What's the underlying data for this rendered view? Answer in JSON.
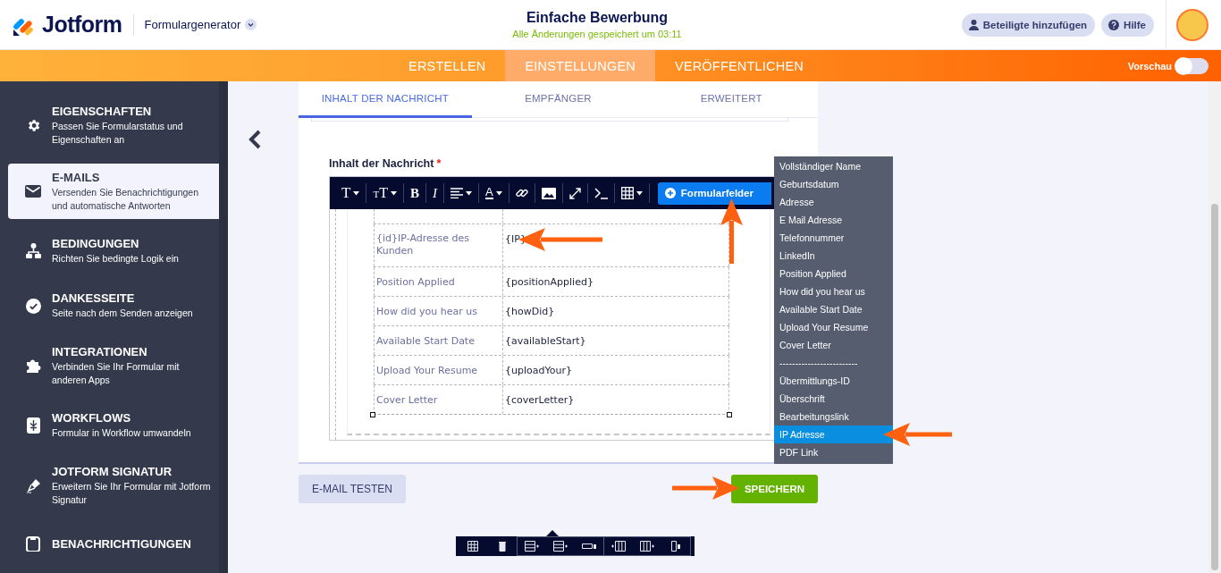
{
  "header": {
    "logo": "Jotform",
    "product": "Formulargenerator",
    "title": "Einfache Bewerbung",
    "save_status": "Alle Änderungen gespeichert um 03:11",
    "buttons": [
      {
        "label": "Beteiligte hinzufügen",
        "kind": "person"
      },
      {
        "label": "Hilfe",
        "kind": "help"
      }
    ]
  },
  "nav": {
    "tabs": [
      {
        "label": "ERSTELLEN",
        "selected": false
      },
      {
        "label": "EINSTELLUNGEN",
        "selected": true
      },
      {
        "label": "VERÖFFENTLICHEN",
        "selected": false
      }
    ],
    "preview": {
      "label": "Vorschau",
      "on": false
    }
  },
  "sidebar": {
    "items": [
      {
        "title": "EIGENSCHAFTEN",
        "description": "Passen Sie Formularstatus und Eigenschaften an",
        "selected": false
      },
      {
        "title": "E-MAILS",
        "description": "Versenden Sie Benachrichtigungen und automatische Antworten",
        "selected": true
      },
      {
        "title": "BEDINGUNGEN",
        "description": "Richten Sie bedingte Logik ein",
        "selected": false
      },
      {
        "title": "DANKESSEITE",
        "description": "Seite nach dem Senden anzeigen",
        "selected": false
      },
      {
        "title": "INTEGRATIONEN",
        "description": "Verbinden Sie Ihr Formular mit anderen Apps",
        "selected": false
      },
      {
        "title": "WORKFLOWS",
        "description": "Formular in Workflow umwandeln",
        "selected": false
      },
      {
        "title": "JOTFORM SIGNATUR",
        "description": "Erweitern Sie Ihr Formular mit Jotform Signatur",
        "selected": false
      },
      {
        "title": "BENACHRICHTIGUNGEN",
        "selected": false
      }
    ]
  },
  "card": {
    "tabs": [
      {
        "label": "INHALT DER NACHRICHT",
        "selected": true
      },
      {
        "label": "EMPFÄNGER",
        "selected": false
      },
      {
        "label": "ERWEITERT",
        "selected": false
      }
    ],
    "field_label": "Inhalt der Nachricht",
    "required_mark": "*",
    "toolbar": {
      "tools": [
        {
          "kind": "glyph",
          "label": "T",
          "menu": true
        },
        {
          "kind": "size",
          "prefix": "T",
          "label": "T",
          "menu": true
        },
        {
          "kind": "bold",
          "label": "B",
          "menu": false
        },
        {
          "kind": "italic",
          "label": "I",
          "menu": false
        },
        {
          "kind": "align",
          "menu": true
        },
        {
          "kind": "color",
          "label": "A",
          "menu": true
        },
        {
          "kind": "link",
          "menu": false
        },
        {
          "kind": "image",
          "menu": false
        },
        {
          "kind": "expand",
          "menu": false
        },
        {
          "kind": "code",
          "menu": false
        },
        {
          "kind": "table",
          "menu": true
        }
      ],
      "fields_button": "Formularfelder"
    },
    "table_rows": [
      {
        "label": "{id}IP-Adresse des Kunden",
        "tag": "{IP}"
      },
      {
        "label": "Position Applied",
        "tag": "{positionApplied}"
      },
      {
        "label": "How did you hear us",
        "tag": "{howDid}"
      },
      {
        "label": "Available Start Date",
        "tag": "{availableStart}"
      },
      {
        "label": "Upload Your Resume",
        "tag": "{uploadYour}"
      },
      {
        "label": "Cover Letter",
        "tag": "{coverLetter}"
      }
    ],
    "buttons": [
      {
        "label": "E-MAIL TESTEN",
        "kind": "secondary"
      },
      {
        "label": "SPEICHERN",
        "kind": "primary"
      }
    ]
  },
  "fields_menu": {
    "items": [
      {
        "label": "Vollständiger Name",
        "selected": false
      },
      {
        "label": "Geburtsdatum",
        "selected": false
      },
      {
        "label": "Adresse",
        "selected": false
      },
      {
        "label": "E Mail Adresse",
        "selected": false
      },
      {
        "label": "Telefonnummer",
        "selected": false
      },
      {
        "label": "LinkedIn",
        "selected": false
      },
      {
        "label": "Position Applied",
        "selected": false
      },
      {
        "label": "How did you hear us",
        "selected": false
      },
      {
        "label": "Available Start Date",
        "selected": false
      },
      {
        "label": "Upload Your Resume",
        "selected": false
      },
      {
        "label": "Cover Letter",
        "selected": false
      },
      {
        "label": "-------------------------",
        "selected": false
      },
      {
        "label": "Übermittlungs-ID",
        "selected": false
      },
      {
        "label": "Überschrift",
        "selected": false
      },
      {
        "label": "Bearbeitungslink",
        "selected": false
      },
      {
        "label": "IP Adresse",
        "selected": true
      },
      {
        "label": "PDF Link",
        "selected": false
      }
    ]
  }
}
